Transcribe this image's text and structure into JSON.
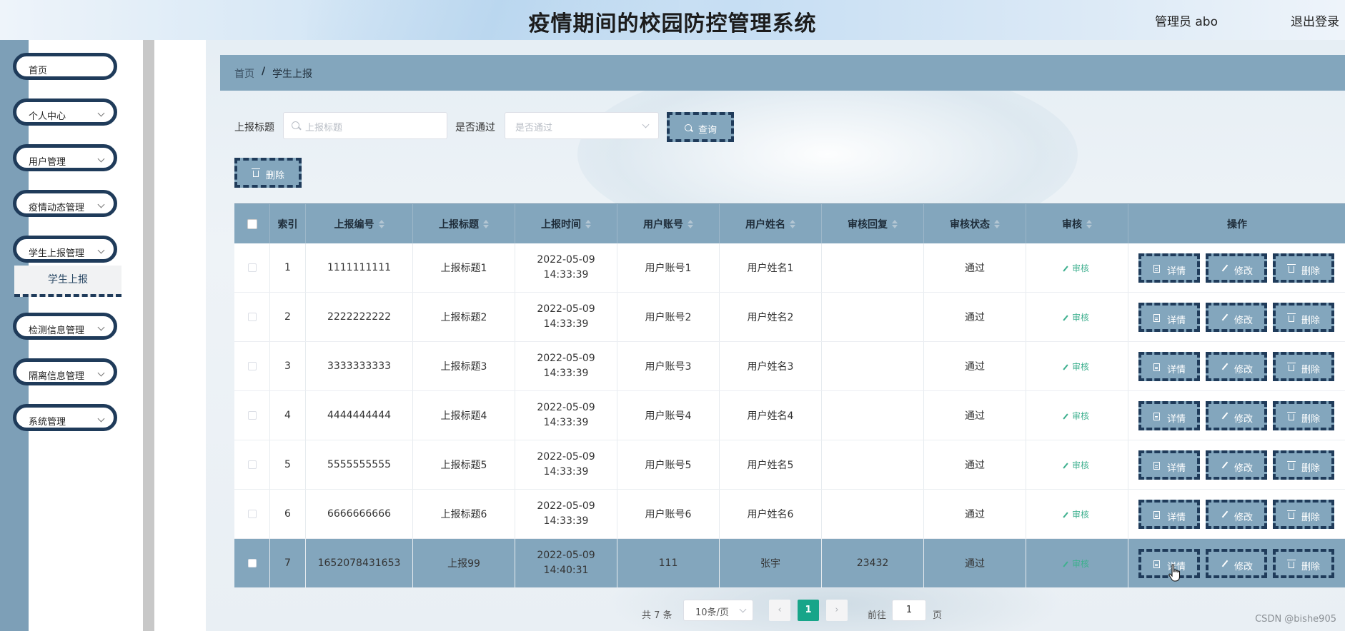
{
  "header": {
    "title": "疫情期间的校园防控管理系统",
    "admin": "管理员 abo",
    "logout": "退出登录"
  },
  "sidebar": {
    "items": [
      {
        "label": "首页"
      },
      {
        "label": "个人中心"
      },
      {
        "label": "用户管理"
      },
      {
        "label": "疫情动态管理"
      },
      {
        "label": "学生上报管理"
      },
      {
        "label": "检测信息管理"
      },
      {
        "label": "隔离信息管理"
      },
      {
        "label": "系统管理"
      }
    ],
    "submenu_active": "学生上报"
  },
  "breadcrumb": {
    "home": "首页",
    "sep": "/",
    "current": "学生上报"
  },
  "filters": {
    "title_label": "上报标题",
    "title_placeholder": "上报标题",
    "passed_label": "是否通过",
    "passed_placeholder": "是否通过",
    "query_btn": "查询",
    "delete_btn": "删除"
  },
  "table": {
    "headers": [
      "索引",
      "上报编号",
      "上报标题",
      "上报时间",
      "用户账号",
      "用户姓名",
      "审核回复",
      "审核状态",
      "审核",
      "操作"
    ],
    "audit_link": "审核",
    "actions": {
      "detail": "详情",
      "edit": "修改",
      "delete": "删除"
    },
    "rows": [
      {
        "index": "1",
        "code": "1111111111",
        "title": "上报标题1",
        "time": "2022-05-09 14:33:39",
        "account": "用户账号1",
        "name": "用户姓名1",
        "reply": "",
        "status": "通过"
      },
      {
        "index": "2",
        "code": "2222222222",
        "title": "上报标题2",
        "time": "2022-05-09 14:33:39",
        "account": "用户账号2",
        "name": "用户姓名2",
        "reply": "",
        "status": "通过"
      },
      {
        "index": "3",
        "code": "3333333333",
        "title": "上报标题3",
        "time": "2022-05-09 14:33:39",
        "account": "用户账号3",
        "name": "用户姓名3",
        "reply": "",
        "status": "通过"
      },
      {
        "index": "4",
        "code": "4444444444",
        "title": "上报标题4",
        "time": "2022-05-09 14:33:39",
        "account": "用户账号4",
        "name": "用户姓名4",
        "reply": "",
        "status": "通过"
      },
      {
        "index": "5",
        "code": "5555555555",
        "title": "上报标题5",
        "time": "2022-05-09 14:33:39",
        "account": "用户账号5",
        "name": "用户姓名5",
        "reply": "",
        "status": "通过"
      },
      {
        "index": "6",
        "code": "6666666666",
        "title": "上报标题6",
        "time": "2022-05-09 14:33:39",
        "account": "用户账号6",
        "name": "用户姓名6",
        "reply": "",
        "status": "通过"
      },
      {
        "index": "7",
        "code": "1652078431653",
        "title": "上报99",
        "time": "2022-05-09 14:40:31",
        "account": "111",
        "name": "张宇",
        "reply": "23432",
        "status": "通过"
      }
    ]
  },
  "pagination": {
    "total": "共 7 条",
    "page_size": "10条/页",
    "prev": "‹",
    "current": "1",
    "next": "›",
    "goto_label": "前往",
    "goto_value": "1",
    "goto_unit": "页"
  },
  "watermark": "CSDN @bishe905",
  "colors": {
    "accent": "#83a6bd",
    "border_dark": "#1f3b5a",
    "pager_active": "#17a589",
    "audit_link": "#3fb08f"
  }
}
